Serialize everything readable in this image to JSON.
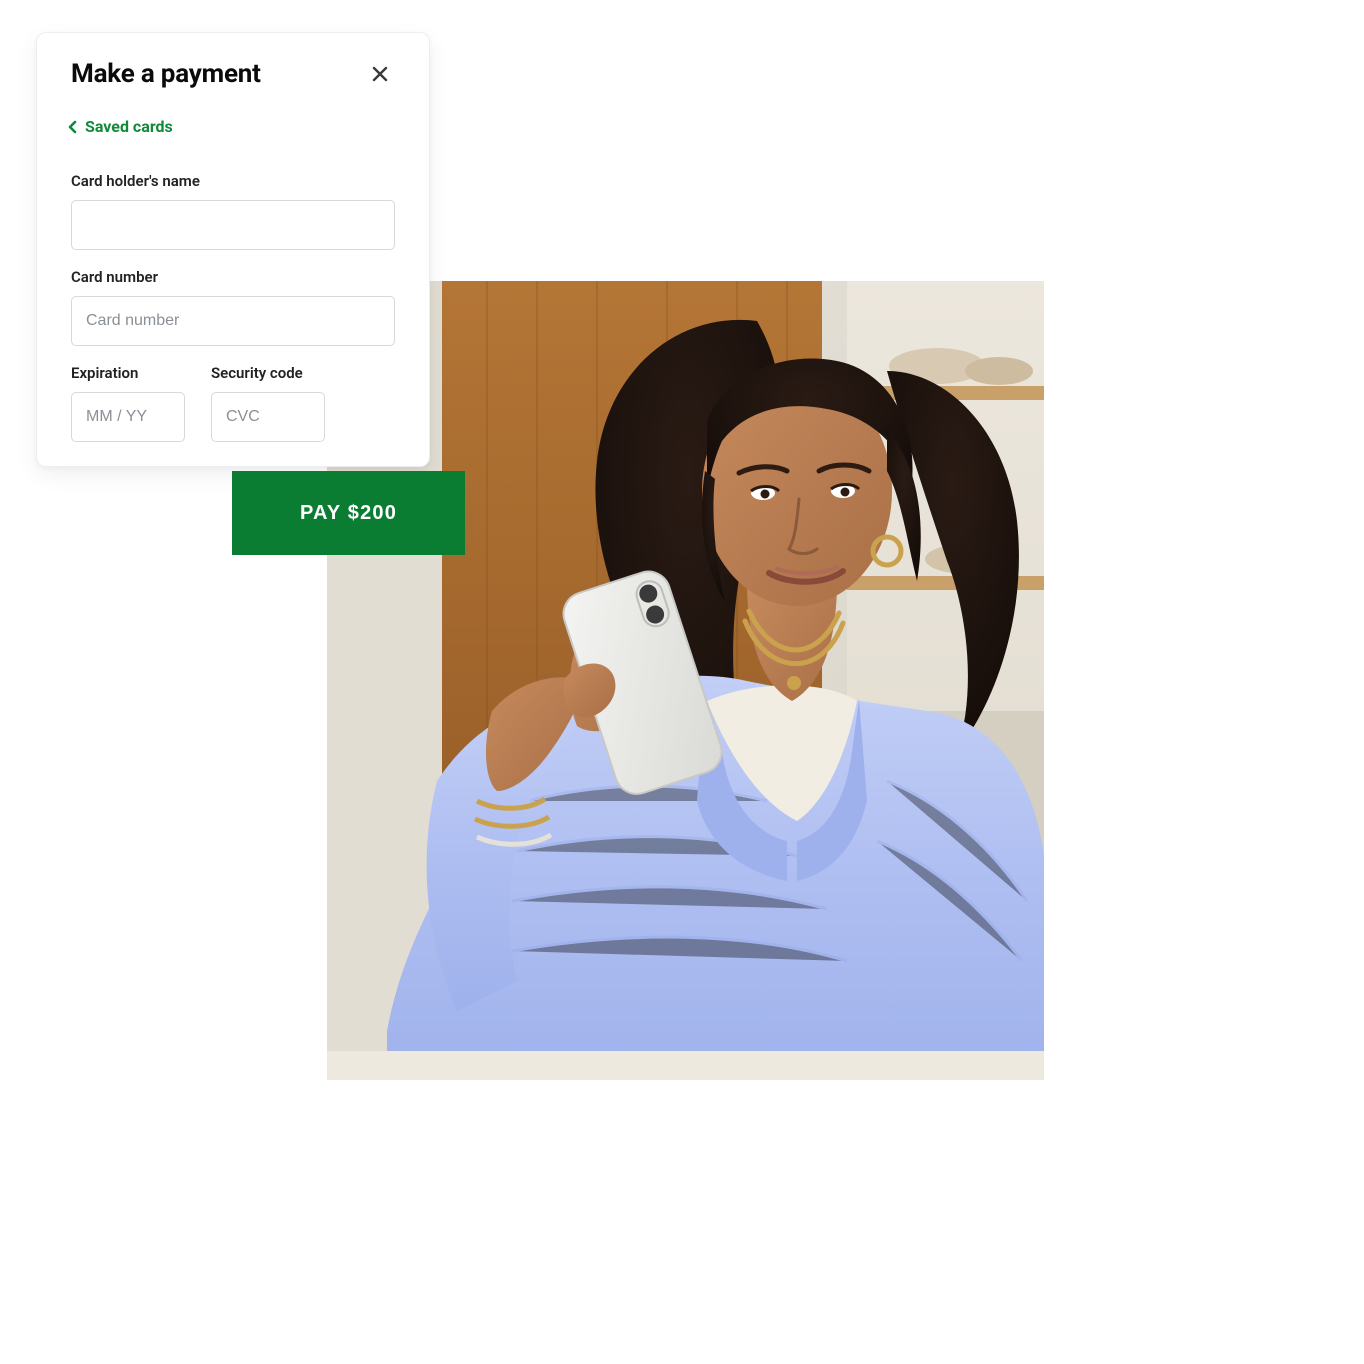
{
  "modal": {
    "title": "Make a payment",
    "back_link": "Saved cards",
    "fields": {
      "cardholder": {
        "label": "Card holder's name",
        "value": ""
      },
      "cardnumber": {
        "label": "Card number",
        "placeholder": "Card number",
        "value": ""
      },
      "expiration": {
        "label": "Expiration",
        "placeholder": "MM / YY",
        "value": ""
      },
      "cvc": {
        "label": "Security code",
        "placeholder": "CVC",
        "value": ""
      }
    }
  },
  "pay_button": {
    "label": "PAY $200"
  },
  "colors": {
    "accent": "#0a7d33",
    "link": "#0f8a3b"
  }
}
